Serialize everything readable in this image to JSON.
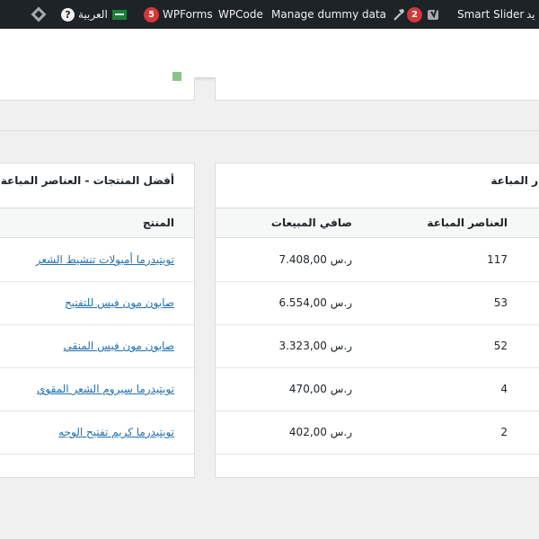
{
  "adminbar": {
    "smart_slider": "Smart Slider",
    "yoast_count": "2",
    "manage_dummy": "Manage dummy data",
    "wpcode": "WPCode",
    "wpforms": "WPForms",
    "wpforms_count": "5",
    "language": "العربية",
    "help": "?",
    "right_clip": "يد"
  },
  "left_panel": {
    "title": "أفضل المنتجات - العناصر المباعة",
    "col_product": "المنتج",
    "products": [
      "تويتيدرما أمبولات تنشيط الشعر",
      "صابون مون فيس للتفتيح",
      "صابون مون فيس المنقي",
      "تويتيدرما سيروم الشعر المقوي",
      "تويتيدرما كريم تفتيح الوجه"
    ]
  },
  "right_panel": {
    "title": "ر المباعة",
    "col_items": "العناصر المباعة",
    "col_net": "صافي المبيعات",
    "rows": [
      {
        "items": "117",
        "net": "7.408,00 ر.س"
      },
      {
        "items": "53",
        "net": "6.554,00 ر.س"
      },
      {
        "items": "52",
        "net": "3.323,00 ر.س"
      },
      {
        "items": "4",
        "net": "470,00 ر.س"
      },
      {
        "items": "2",
        "net": "402,00 ر.س"
      }
    ]
  }
}
